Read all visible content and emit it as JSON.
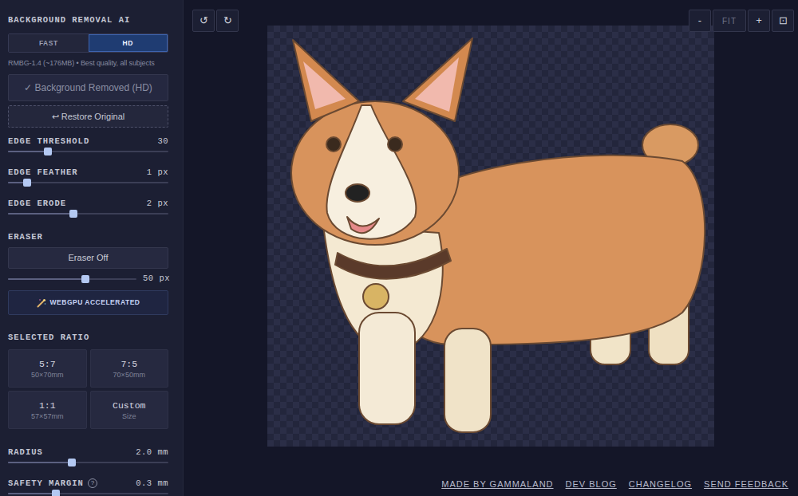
{
  "sidebar": {
    "title": "BACKGROUND REMOVAL AI",
    "modes": [
      {
        "label": "FAST",
        "selected": false
      },
      {
        "label": "HD",
        "selected": true
      }
    ],
    "model_info": "RMBG-1.4 (~176MB) • Best quality, all subjects",
    "remove_button": {
      "label": "✓ Background Removed (HD)",
      "disabled": true
    },
    "restore_button": {
      "label": "↩ Restore Original"
    },
    "edge_sliders": [
      {
        "label": "EDGE THRESHOLD",
        "reading": "30",
        "level": 0.25
      },
      {
        "label": "EDGE FEATHER",
        "reading": "1 px",
        "level": 0.12
      },
      {
        "label": "EDGE ERODE",
        "reading": "2 px",
        "level": 0.41
      }
    ],
    "eraser": {
      "label": "ERASER",
      "button": "Eraser Off",
      "on": false,
      "reading": "50 px",
      "level": 0.6
    },
    "gpu_button": {
      "label": "WEBGPU ACCELERATED"
    },
    "ratio": {
      "label": "SELECTED RATIO",
      "options": [
        {
          "title": "5:7",
          "size": "50×70mm",
          "selected": false
        },
        {
          "title": "7:5",
          "size": "70×50mm",
          "selected": false
        },
        {
          "title": "1:1",
          "size": "57×57mm",
          "selected": false
        },
        {
          "title": "Custom",
          "size": "Size",
          "selected": false
        }
      ]
    },
    "size_sliders": [
      {
        "label": "RADIUS",
        "reading": "2.0 mm",
        "level": 0.4
      },
      {
        "label": "SAFETY MARGIN",
        "help": "?",
        "reading": "0.3 mm",
        "level": 0.3
      }
    ]
  },
  "toolbar": {
    "history": [
      {
        "label": "↺"
      },
      {
        "label": "↻"
      }
    ],
    "zoom": [
      {
        "label": "-",
        "disabled": false
      },
      {
        "label": "FIT",
        "disabled": true
      },
      {
        "label": "+",
        "disabled": false
      },
      {
        "label": "⊡",
        "disabled": false
      }
    ]
  },
  "footer": {
    "links": [
      "MADE BY GAMMALAND",
      "DEV BLOG",
      "CHANGELOG",
      "SEND FEEDBACK"
    ]
  }
}
